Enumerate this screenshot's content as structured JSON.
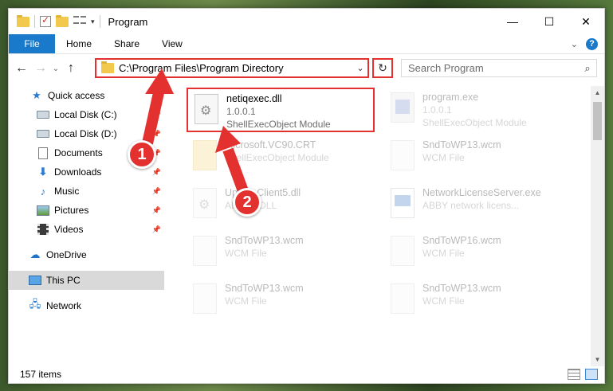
{
  "window": {
    "title": "Program",
    "controls": {
      "minimize": "—",
      "maximize": "☐",
      "close": "✕"
    }
  },
  "ribbon": {
    "tabs": [
      "File",
      "Home",
      "Share",
      "View"
    ],
    "help": "?"
  },
  "address": {
    "path": "C:\\Program Files\\Program Directory",
    "search_placeholder": "Search Program"
  },
  "sidebar": {
    "items": [
      {
        "label": "Quick access",
        "icon": "star-icon",
        "pinned": false
      },
      {
        "label": "Local Disk (C:)",
        "icon": "disk-icon",
        "pinned": true
      },
      {
        "label": "Local Disk (D:)",
        "icon": "disk-icon",
        "pinned": true
      },
      {
        "label": "Documents",
        "icon": "documents-icon",
        "pinned": true
      },
      {
        "label": "Downloads",
        "icon": "downloads-icon",
        "pinned": true
      },
      {
        "label": "Music",
        "icon": "music-icon",
        "pinned": true
      },
      {
        "label": "Pictures",
        "icon": "pictures-icon",
        "pinned": true
      },
      {
        "label": "Videos",
        "icon": "videos-icon",
        "pinned": true
      }
    ],
    "onedrive": "OneDrive",
    "thispc": "This PC",
    "network": "Network"
  },
  "files": [
    {
      "name": "netiqexec.dll",
      "line2": "1.0.0.1",
      "line3": "ShellExecObject Module",
      "icon": "dll-icon"
    },
    {
      "name": "program.exe",
      "line2": "1.0.0.1",
      "line3": "ShellExecObject Module",
      "icon": "exe-icon"
    },
    {
      "name": "Microsoft.VC90.CRT",
      "line2": "",
      "line3": "ShellExecObject Module",
      "icon": "folder-icon"
    },
    {
      "name": "SndToWP13.wcm",
      "line2": "WCM File",
      "line3": "",
      "icon": "file-icon"
    },
    {
      "name": "UpdateClient5.dll",
      "line2": "ABBYY DLL",
      "line3": "",
      "icon": "dll-icon"
    },
    {
      "name": "NetworkLicenseServer.exe",
      "line2": "ABBY network licens...",
      "line3": "",
      "icon": "app-icon"
    },
    {
      "name": "SndToWP13.wcm",
      "line2": "WCM File",
      "line3": "",
      "icon": "file-icon"
    },
    {
      "name": "SndToWP16.wcm",
      "line2": "WCM File",
      "line3": "",
      "icon": "file-icon"
    },
    {
      "name": "SndToWP13.wcm",
      "line2": "WCM File",
      "line3": "",
      "icon": "file-icon"
    },
    {
      "name": "SndToWP13.wcm",
      "line2": "WCM File",
      "line3": "",
      "icon": "file-icon"
    }
  ],
  "status": {
    "count": "157 items"
  },
  "callouts": [
    "1",
    "2"
  ],
  "colors": {
    "accent": "#1979ca",
    "annotation": "#e2312f"
  }
}
